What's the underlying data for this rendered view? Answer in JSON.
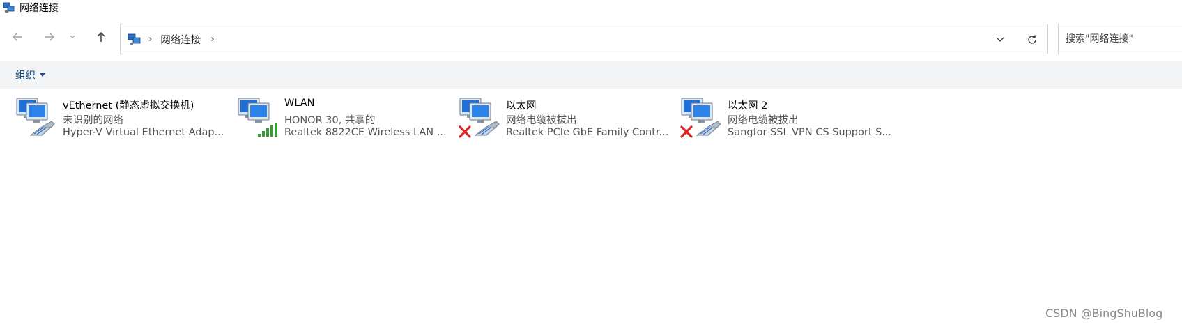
{
  "window": {
    "title": "网络连接",
    "icon": "network-connections-icon"
  },
  "navigation": {
    "back_icon": "back-arrow-icon",
    "forward_icon": "forward-arrow-icon",
    "recent_icon": "chevron-down-icon",
    "up_icon": "up-arrow-icon"
  },
  "address": {
    "crumb": "网络连接",
    "separator": "›",
    "dropdown_icon": "chevron-down-icon",
    "refresh_icon": "refresh-icon"
  },
  "search": {
    "placeholder": "搜索\"网络连接\""
  },
  "commandbar": {
    "organize_label": "组织"
  },
  "connections": [
    {
      "name": "vEthernet (静态虚拟交换机)",
      "status": "未识别的网络",
      "adapter": "Hyper-V Virtual Ethernet Adap...",
      "state": "ethernet-connected"
    },
    {
      "name": "WLAN",
      "status": "HONOR 30, 共享的",
      "adapter": "Realtek 8822CE Wireless LAN ...",
      "state": "wifi-connected"
    },
    {
      "name": "以太网",
      "status": "网络电缆被拔出",
      "adapter": "Realtek PCIe GbE Family Contr...",
      "state": "disconnected"
    },
    {
      "name": "以太网 2",
      "status": "网络电缆被拔出",
      "adapter": "Sangfor SSL VPN CS Support S...",
      "state": "disconnected"
    }
  ],
  "watermark": "CSDN @BingShuBlog",
  "colors": {
    "accent": "#1a4f8a",
    "commandbar_bg": "#f3f4f6",
    "disconnect_red": "#e02020",
    "signal_green": "#3a9a3a"
  }
}
